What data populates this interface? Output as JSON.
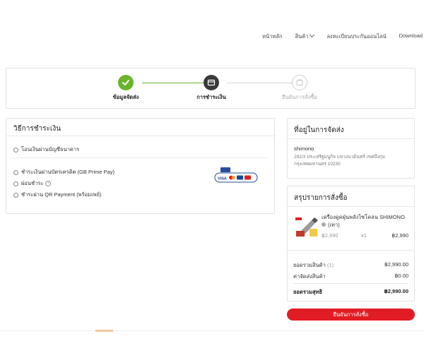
{
  "nav": {
    "home": "หน้าหลัก",
    "products": "สินค้า",
    "warranty": "ลงทะเบียนประกันออนไลน์",
    "download": "Download"
  },
  "steps": [
    {
      "label": "ข้อมูลจัดส่ง"
    },
    {
      "label": "การชำระเงิน"
    },
    {
      "label": "ยืนยันการสั่งซื้อ"
    }
  ],
  "payment": {
    "title": "วิธีการชำระเงิน",
    "options": [
      "โอนเงินผ่านบัญชีธนาคาร",
      "ชำระเงินผ่านบัตรเครดิต (GB Prime Pay)",
      "ผ่อนชำระ",
      "ชำระผ่าน QR Payment (พร้อมเพย์)"
    ],
    "card_logos": [
      "VISA",
      "mastercard",
      "JCB",
      "UnionPay"
    ]
  },
  "shipping": {
    "title": "ที่อยู่ในการจัดส่ง",
    "name": "shimono",
    "address_line1": "292/3 ประเสริฐมนูกิจ แขวงนวมินทร์ เขตบึงกุ่ม",
    "address_line2": "กรุงเทพมหานคร 10230"
  },
  "summary": {
    "title": "สรุปรายการสั่งซื้อ",
    "product_name": "เครื่องดูดฝุ่นพลังไซโคลน SHIMONO",
    "product_variant": "(เทา)",
    "unit_price": "฿2,990",
    "qty": "x1",
    "line_total": "฿2,990",
    "subtotal_label": "ยอดรวมสินค้า",
    "subtotal_count": "(1)",
    "subtotal_value": "฿2,990.00",
    "shipping_label": "ค่าจัดส่งสินค้า",
    "shipping_value": "฿0.00",
    "total_label": "ยอดรวมสุทธิ",
    "total_value": "฿2,990.00"
  },
  "confirm_label": "ยืนยันการสั่งซื้อ",
  "colors": {
    "accent": "#e21c24",
    "done": "#6ab42d",
    "active": "#3a3a3a"
  }
}
